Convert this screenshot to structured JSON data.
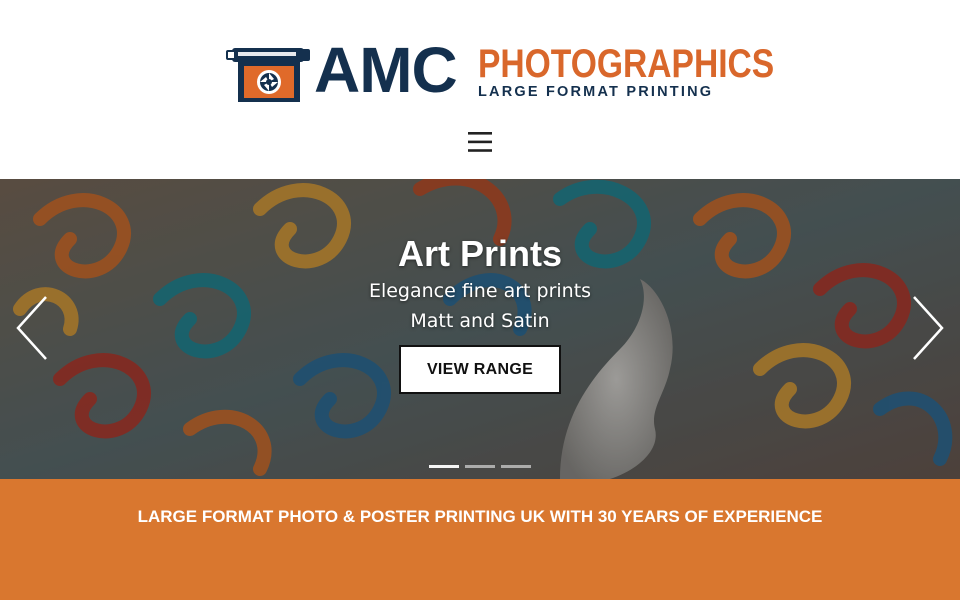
{
  "header": {
    "logo": {
      "brand": "AMC",
      "name": "PHOTOGRAPHICS",
      "tagline": "LARGE FORMAT PRINTING",
      "navy": "#14304e",
      "orange": "#d9672b"
    },
    "menu_icon": "hamburger-menu-icon"
  },
  "hero": {
    "title": "Art Prints",
    "subtitle_line1": "Elegance fine art prints",
    "subtitle_line2": "Matt and Satin",
    "cta_label": "VIEW RANGE",
    "prev_icon": "chevron-left-icon",
    "next_icon": "chevron-right-icon",
    "slide_count": 3,
    "active_slide": 1
  },
  "banner": {
    "text": "LARGE FORMAT PHOTO & POSTER PRINTING UK WITH 30 YEARS OF EXPERIENCE",
    "color": "#d9772f"
  }
}
